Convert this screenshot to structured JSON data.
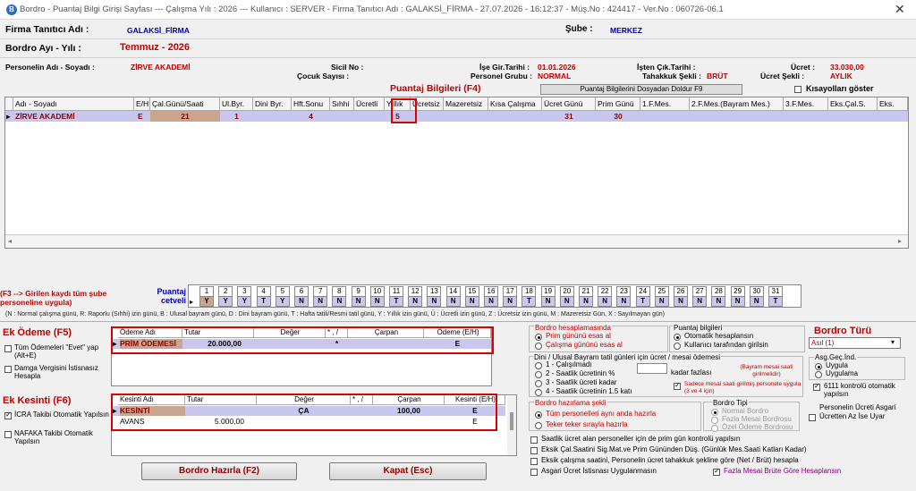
{
  "window": {
    "title": "Bordro - Puantaj Bilgi Girişi Sayfası  ---  Çalışma Yılı : 2026  ---  Kullanıcı : SERVER - Firma Tanıtıcı Adı : GALAKSİ_FİRMA - 27.07.2026 - 16:12:37 - Müş.No : 424417 - Ver.No : 060726-06.1",
    "close": "✕"
  },
  "header": {
    "firma_label": "Firma Tanıtıcı Adı :",
    "firma_value": "GALAKSİ_FİRMA",
    "sube_label": "Şube :",
    "sube_value": "MERKEZ",
    "bordro_label": "Bordro Ayı - Yılı :",
    "bordro_value": "Temmuz  -  2026",
    "personel_label": "Personelin Adı - Soyadı :",
    "personel_value": "ZİRVE  AKADEMİ",
    "sicil_label": "Sicil No :",
    "cocuk_label": "Çocuk Sayısı :",
    "giris_label": "İşe Gir.Tarihi :",
    "giris_value": "01.01.2026",
    "grup_label": "Personel Grubu :",
    "grup_value": "NORMAL",
    "cikis_label": "İşten Çık.Tarihi :",
    "tahakkuk_label": "Tahakkuk Şekli :",
    "tahakkuk_value": "BRÜT",
    "ucret_label": "Ücret :",
    "ucret_value": "33.030,00",
    "ucret_sekli_label": "Ücret Şekli :",
    "ucret_sekli_value": "AYLIK"
  },
  "puantaj": {
    "title": "Puantaj Bilgileri (F4)",
    "fill_button": "Puantaj Bilgilerini Dosyadan Doldur F9",
    "shortcut_label": "Kısayolları göster",
    "columns": [
      "Adı - Soyadı",
      "E/H",
      "Çal.Günü/Saati",
      "Ul.Byr.",
      "Dini Byr.",
      "Hft.Sonu",
      "Sıhhi",
      "Ücretli",
      "Yıllık",
      "Ücretsiz",
      "Mazeretsiz",
      "Kısa Çalışma",
      "Ücret Günü",
      "Prim Günü",
      "1.F.Mes.",
      "2.F.Mes.(Bayram Mes.)",
      "3.F.Mes.",
      "Eks.Çal.S.",
      "Eks."
    ],
    "row": [
      "ZİRVE  AKADEMİ",
      "E",
      "21",
      "1",
      "",
      "4",
      "",
      "",
      "5",
      "",
      "",
      "",
      "31",
      "30",
      "",
      "",
      "",
      "",
      ""
    ]
  },
  "cetvel": {
    "note": "(F3 --> Girilen kaydı tüm şube personeline uygula)",
    "label": "Puantaj cetveli",
    "days": [
      "1",
      "2",
      "3",
      "4",
      "5",
      "6",
      "7",
      "8",
      "9",
      "10",
      "11",
      "12",
      "13",
      "14",
      "15",
      "16",
      "17",
      "18",
      "19",
      "20",
      "21",
      "22",
      "23",
      "24",
      "25",
      "26",
      "27",
      "28",
      "29",
      "30",
      "31"
    ],
    "codes": [
      "Y",
      "Y",
      "Y",
      "T",
      "Y",
      "N",
      "N",
      "N",
      "N",
      "N",
      "T",
      "N",
      "N",
      "N",
      "N",
      "N",
      "N",
      "T",
      "N",
      "N",
      "N",
      "N",
      "N",
      "T",
      "N",
      "N",
      "N",
      "N",
      "N",
      "N",
      "T"
    ],
    "legend": "(N : Normal çalışma günü, R: Raporlu (Sıhhi) izin günü, B : Ulusal bayram günü, D : Dini bayram günü, T : Hafta tatili/Resmi tatil günü, Y : Yıllık izin günü, Ü : Ücretli izin günü, Z : Ücretsiz izin günü, M : Mazeretsiz Gün, X : Sayılmayan gün)"
  },
  "ek_odeme": {
    "title": "Ek Ödeme (F5)",
    "opt1": "Tüm Ödemeleri \"Evet\" yap (Alt+E)",
    "opt2": "Damga Vergisini İstisnasız Hesapla",
    "columns": [
      "Ödeme Adı",
      "Tutar",
      "Değer",
      "* , /",
      "Çarpan",
      "Ödeme (E/H)"
    ],
    "row": [
      "PRİM ÖDEMESİ",
      "20.000,00",
      "",
      "*",
      "",
      "E"
    ]
  },
  "ek_kesinti": {
    "title": "Ek Kesinti (F6)",
    "opt1": "İCRA Takibi Otomatik Yapılsın",
    "opt2": "NAFAKA Takibi Otomatik Yapılsın",
    "columns": [
      "Kesinti Adı",
      "Tutar",
      "Değer",
      "* , /",
      "Çarpan",
      "Kesinti (E/H)"
    ],
    "rows": [
      [
        "KESİNTİ",
        "",
        "ÇA",
        "",
        "100,00",
        "E"
      ],
      [
        "AVANS",
        "5.000,00",
        "",
        "",
        "",
        "E"
      ]
    ]
  },
  "bordro_hesap": {
    "title": "Bordro hesaplamasında",
    "opt1": "Prim gününü esas al",
    "opt2": "Çalışma gününü esas al"
  },
  "puantaj_bilgileri": {
    "title": "Puantaj bilgileri",
    "opt1": "Otomatik hesaplansın",
    "opt2": "Kullanıcı tarafından girilsin"
  },
  "bordro_turu": {
    "title": "Bordro Türü",
    "value": "Asıl (1)"
  },
  "dini": {
    "title": "Dini / Ulusal Bayram tatil günleri için ücret / mesai ödemesi",
    "opt1": "1 - Çalışılmadı",
    "opt2": "2 - Saatlik ücretinin %",
    "opt3": "3 - Saatlik ücreti kadar",
    "opt4": "4 - Saatlik ücretinin 1.5 katı",
    "kadar": "kadar fazlası",
    "note1": "(Bayram mesai saati girilmelidir)",
    "note2": "Sadece mesai saati girilmiş personele uygula (3 ve 4 için)"
  },
  "asg": {
    "title": "Asg.Geç.İnd.",
    "opt1": "Uygula",
    "opt2": "Uygulama",
    "kontrol": "6111 kontrolü otomatik yapılsın"
  },
  "hazirlama": {
    "title": "Bordro hazırlama şekli",
    "opt1": "Tüm personelleri aynı anda hazırla",
    "opt2": "Teker teker sırayla hazırla"
  },
  "tipi": {
    "title": "Bordro Tipi",
    "opt1": "Normal Bordro",
    "opt2": "Fazla Mesai Bordrosu",
    "opt3": "Özel Ödeme Bordrosu"
  },
  "uyar": "Personelin Ücreti Asgari Ücretten Az İse Uyar",
  "bottom_opts": [
    "Saatlik ücret alan personeller için de prim gün kontrolü yapılsın",
    "Eksik Çal.Saatini Sig.Mat.ve Prim Gününden Düş. (Günlük Mes.Saati Katları Kadar)",
    "Eksik çalışma saatini, Personelin ücret tahakkuk şekline göre (Net / Brüt) hesapla",
    "Asgari Ücret İstisnası Uygulanmasın"
  ],
  "fazla_mesai": "Fazla Mesai Brüte Göre Hesaplansın",
  "buttons": {
    "hazirla": "Bordro Hazırla (F2)",
    "kapat": "Kapat (Esc)"
  }
}
